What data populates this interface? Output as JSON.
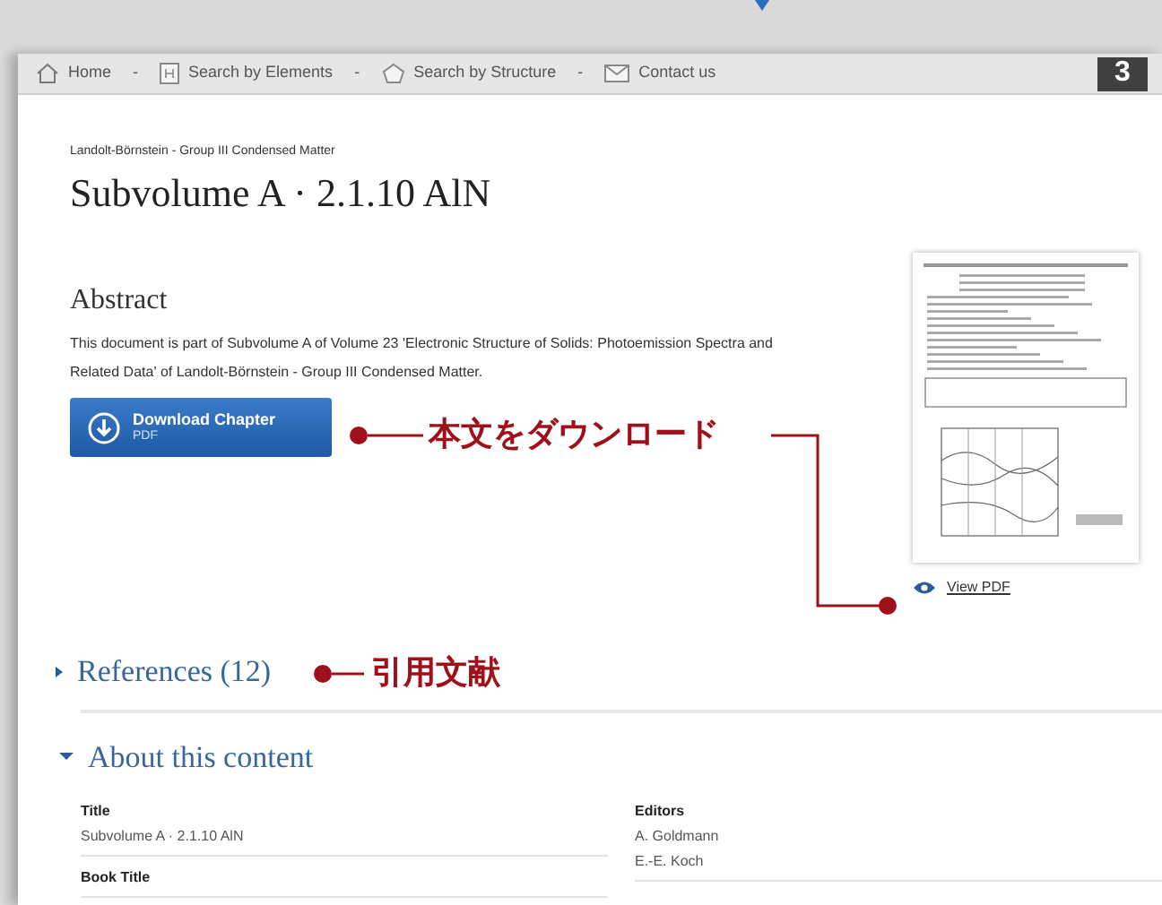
{
  "nav": {
    "items": [
      {
        "label": "Home"
      },
      {
        "label": "Search by Elements"
      },
      {
        "label": "Search by Structure"
      },
      {
        "label": "Contact us"
      }
    ],
    "separators": [
      "-",
      "-",
      "-"
    ]
  },
  "step_badge": "3",
  "breadcrumb": "Landolt-Börnstein - Group III Condensed Matter",
  "title": "Subvolume A · 2.1.10 AlN",
  "abstract": {
    "heading": "Abstract",
    "text": "This document is part of Subvolume A of Volume 23 'Electronic Structure of Solids: Photoemission Spectra and Related Data' of Landolt-Börnstein - Group III Condensed Matter."
  },
  "download_button": {
    "label": "Download Chapter",
    "sublabel": "PDF"
  },
  "preview": {
    "link": "View PDF"
  },
  "sections": [
    {
      "title": "References (12)",
      "expanded": false
    },
    {
      "title": "About this content",
      "expanded": true
    }
  ],
  "details": {
    "left": [
      {
        "label": "Title",
        "values": [
          "Subvolume A · 2.1.10 AlN"
        ]
      },
      {
        "label": "Book Title"
      }
    ],
    "right": [
      {
        "label": "Editors",
        "values": [
          "A. Goldmann",
          "E.-E. Koch"
        ]
      }
    ]
  },
  "annotations": [
    {
      "text": "本文をダウンロード"
    },
    {
      "text": "引用文献"
    }
  ]
}
